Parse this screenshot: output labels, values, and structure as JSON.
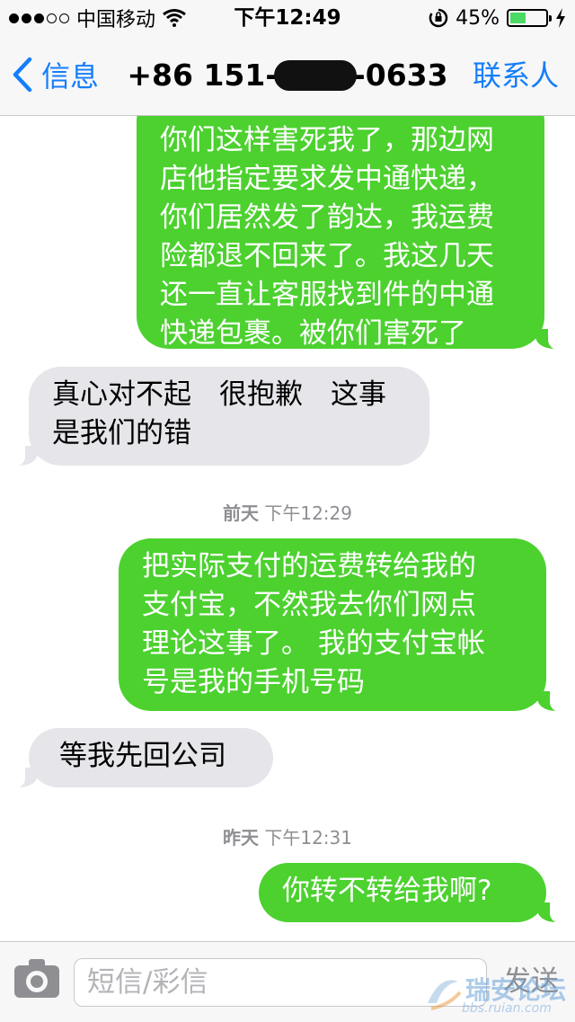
{
  "status_bar": {
    "signal_filled": 3,
    "signal_total": 5,
    "carrier": "中国移动",
    "time": "下午12:49",
    "battery_percent": "45%",
    "battery_level": 0.45
  },
  "nav": {
    "back_label": "信息",
    "title_prefix": "+86 151-",
    "title_suffix": "-0633",
    "contact_label": "联系人"
  },
  "messages": [
    {
      "direction": "outgoing",
      "lines": [
        "你们这样害死我了，那边网",
        "店他指定要求发中通快递，",
        "你们居然发了韵达，我运费",
        "险都退不回来了。我这几天",
        "还一直让客服找到件的中通",
        "快递包裹。被你们害死了"
      ]
    },
    {
      "direction": "incoming",
      "lines": [
        "真心对不起　很抱歉　这事",
        "是我们的错"
      ]
    },
    {
      "direction": "outgoing",
      "lines": [
        "把实际支付的运费转给我的",
        "支付宝，不然我去你们网点",
        "理论这事了。 我的支付宝帐",
        "号是我的手机号码"
      ]
    },
    {
      "direction": "incoming",
      "lines": [
        "等我先回公司"
      ]
    },
    {
      "direction": "outgoing",
      "lines": [
        "你转不转给我啊?"
      ]
    }
  ],
  "timestamps": [
    {
      "day": "前天",
      "time": "下午12:29"
    },
    {
      "day": "昨天",
      "time": "下午12:31"
    }
  ],
  "input": {
    "placeholder": "短信/彩信",
    "send_label": "发送"
  },
  "watermark": {
    "name": "瑞安论坛",
    "url": "bbs.ruian.com"
  },
  "colors": {
    "outgoing_bubble": "#4cd12f",
    "incoming_bubble": "#e5e5ea",
    "accent": "#147efb"
  }
}
